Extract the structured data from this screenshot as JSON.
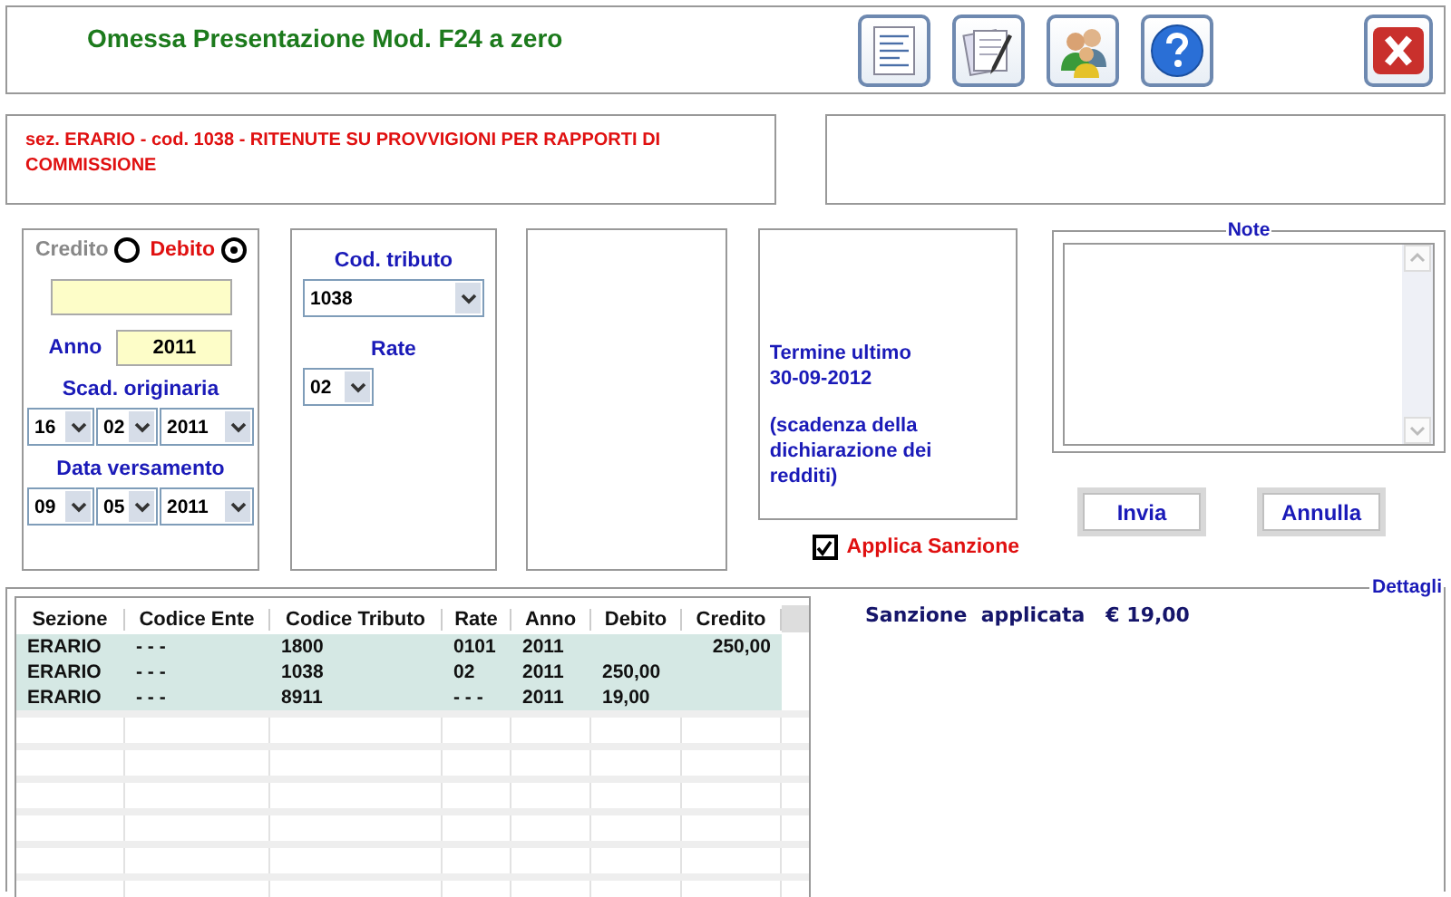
{
  "window": {
    "title": "Omessa Presentazione Mod. F24 a zero"
  },
  "description": "sez. ERARIO - cod. 1038 - RITENUTE SU PROVVIGIONI PER RAPPORTI DI COMMISSIONE",
  "type_radios": [
    {
      "label": "Credito",
      "selected": false
    },
    {
      "label": "Debito",
      "selected": true
    }
  ],
  "anno": {
    "label": "Anno",
    "value": "2011"
  },
  "scadenza": {
    "label": "Scad. originaria",
    "day": "16",
    "month": "02",
    "year": "2011"
  },
  "versamento": {
    "label": "Data versamento",
    "day": "09",
    "month": "05",
    "year": "2011"
  },
  "cod_tributo": {
    "label": "Cod. tributo",
    "value": "1038"
  },
  "rate": {
    "label": "Rate",
    "value": "02"
  },
  "termine": [
    "Termine ultimo\n30-09-2012",
    "(scadenza della dichiarazione dei redditi)"
  ],
  "note": {
    "label": "Note"
  },
  "applica_sanzione": {
    "label": "Applica Sanzione",
    "checked": true
  },
  "buttons": [
    "Invia",
    "Annulla"
  ],
  "details": {
    "label": "Dettagli",
    "sanzione": "Sanzione  applicata   € 19,00"
  },
  "table": {
    "columns": [
      "Sezione",
      "Codice Ente",
      "Codice Tributo",
      "Rate",
      "Anno",
      "Debito",
      "Credito"
    ],
    "rows": [
      [
        "ERARIO",
        "- - -",
        "1800",
        "0101",
        "2011",
        "",
        "250,00"
      ],
      [
        "ERARIO",
        "- - -",
        "1038",
        "02",
        "2011",
        "250,00",
        ""
      ],
      [
        "ERARIO",
        "- - -",
        "8911",
        "- - -",
        "2011",
        "19,00",
        ""
      ]
    ]
  }
}
